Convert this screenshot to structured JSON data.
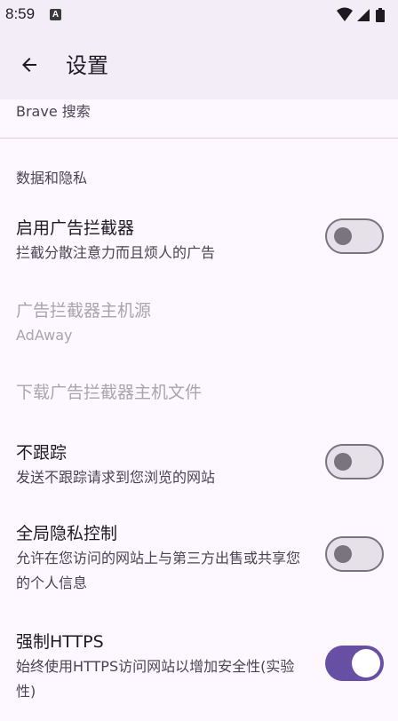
{
  "status_bar": {
    "time": "8:59",
    "app_icon_letter": "A",
    "icons": [
      "wifi-icon",
      "cell-signal-icon",
      "battery-icon"
    ]
  },
  "app_bar": {
    "title": "设置",
    "back_icon": "arrow-left-icon"
  },
  "partial_item": {
    "label": "Brave 搜索"
  },
  "section": {
    "header": "数据和隐私"
  },
  "preferences": [
    {
      "title": "启用广告拦截器",
      "summary": "拦截分散注意力而且烦人的广告",
      "switch": "off",
      "enabled": true
    },
    {
      "title": "广告拦截器主机源",
      "summary": "AdAway",
      "enabled": false
    },
    {
      "title": "下载广告拦截器主机文件",
      "summary": "",
      "enabled": false
    },
    {
      "title": "不跟踪",
      "summary": "发送不跟踪请求到您浏览的网站",
      "switch": "off",
      "enabled": true
    },
    {
      "title": "全局隐私控制",
      "summary": "允许在您访问的网站上与第三方出售或共享您的个人信息",
      "switch": "off",
      "enabled": true
    },
    {
      "title": "强制HTTPS",
      "summary": "始终使用HTTPS访问网站以增加安全性(实验性)",
      "switch": "on",
      "enabled": true
    }
  ],
  "colors": {
    "background": "#fdf7ff",
    "app_bar": "#f3edf7",
    "accent": "#6750a4",
    "switch_off_track": "#e6e0e9",
    "switch_off_outline": "#79747e",
    "text_primary": "#1d1b20",
    "text_secondary": "#49454f",
    "text_disabled": "#a9a5ad"
  }
}
